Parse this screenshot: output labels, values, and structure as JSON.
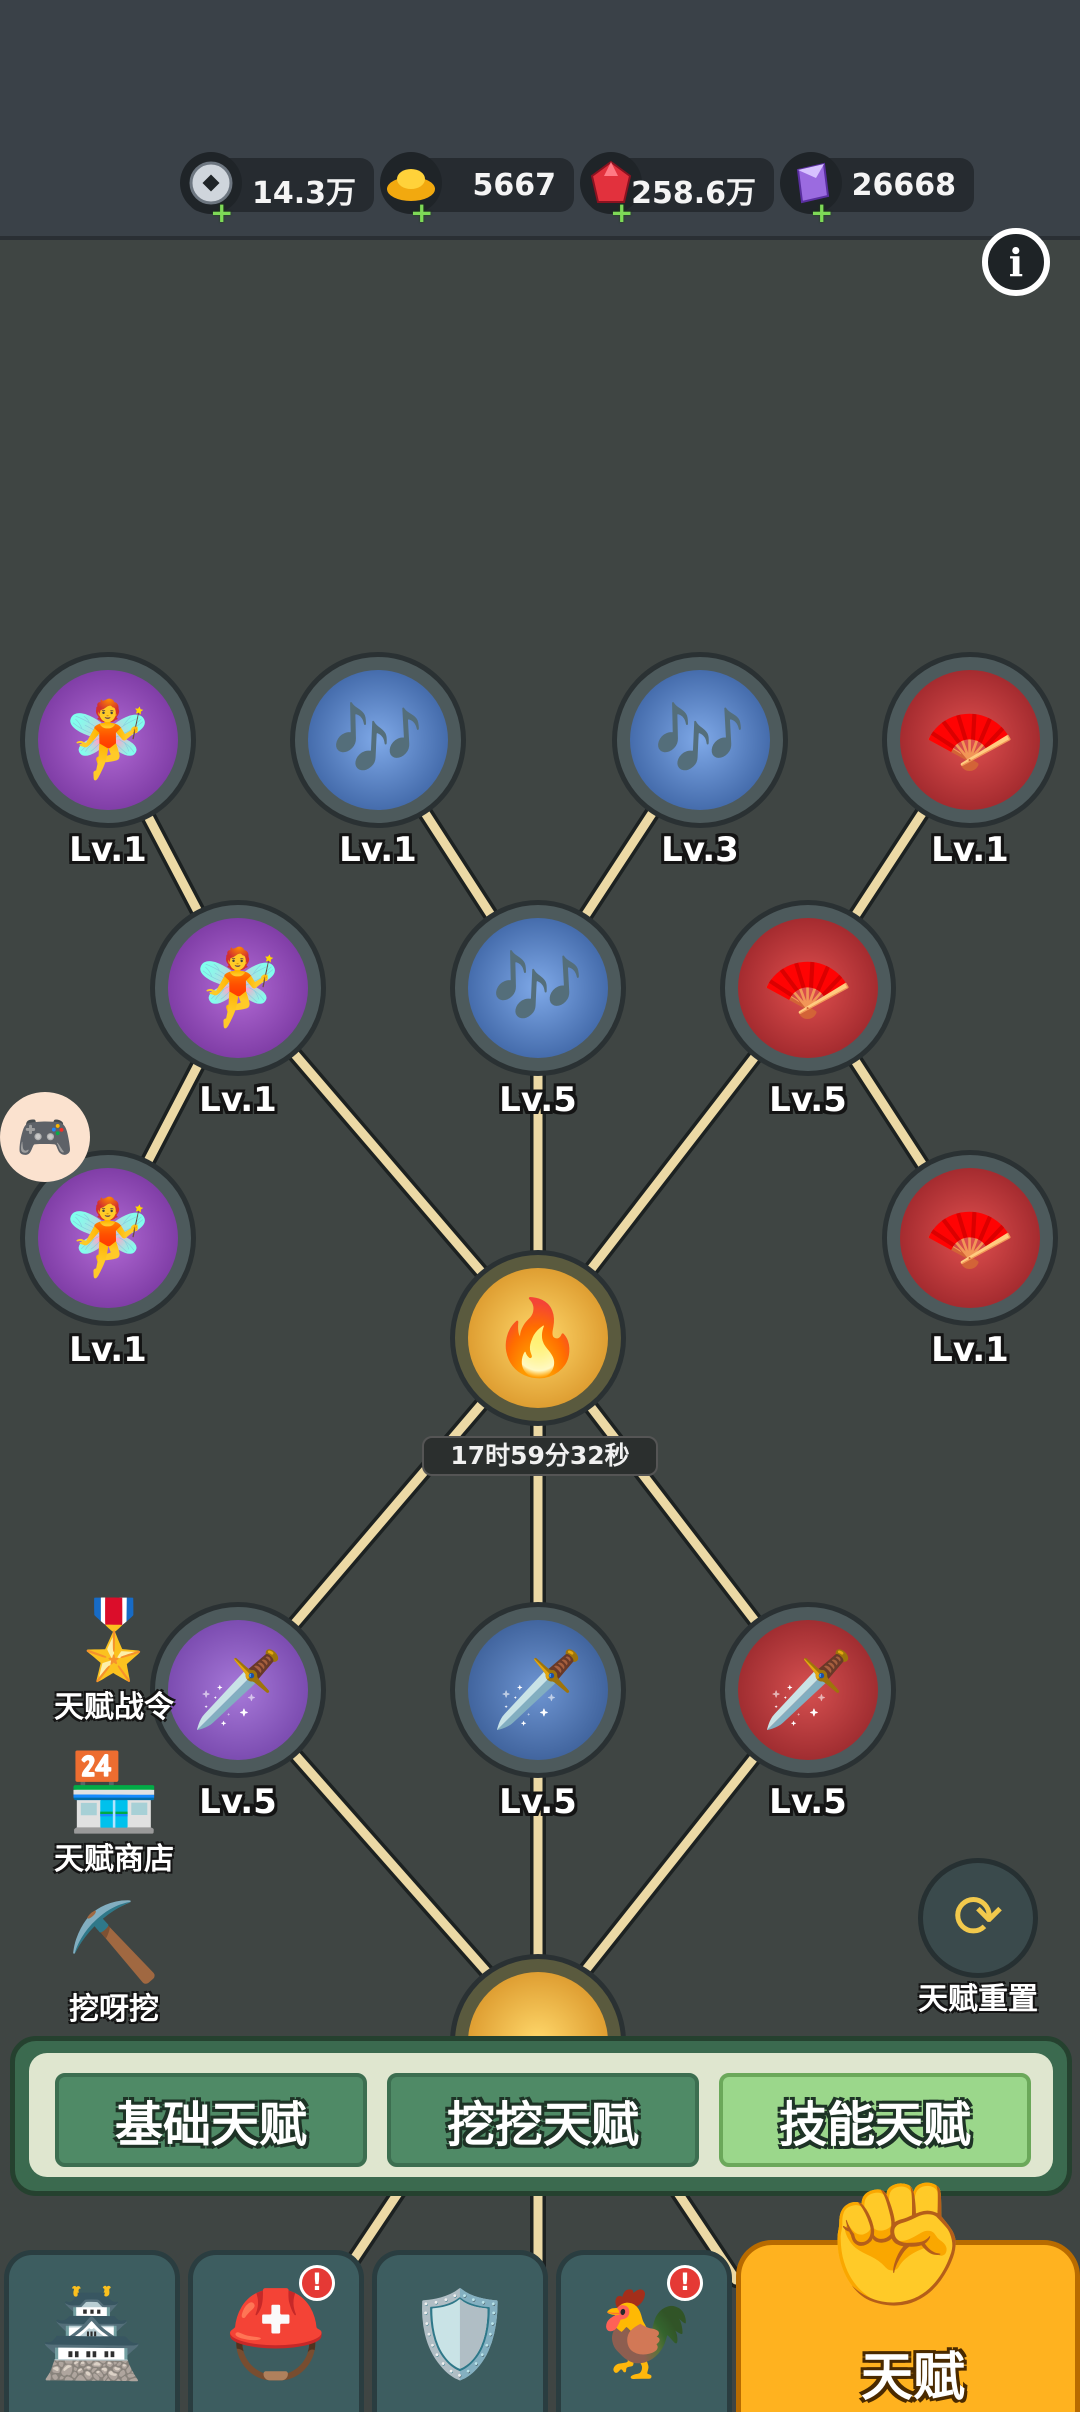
{
  "currencies": [
    {
      "name": "silver-coin-icon",
      "value": "14.3万",
      "color": "#d8dde3"
    },
    {
      "name": "gold-ingot-icon",
      "value": "5667",
      "color": "#f7c21c"
    },
    {
      "name": "red-gem-icon",
      "value": "258.6万",
      "color": "#e2313d"
    },
    {
      "name": "purple-crystal-icon",
      "value": "26668",
      "color": "#9b6be0"
    }
  ],
  "info_label": "i",
  "tree": {
    "row1": [
      {
        "icon": "fairy-icon",
        "glyph": "🧚",
        "level": "Lv.1",
        "theme": "purple"
      },
      {
        "icon": "zither-icon",
        "glyph": "🎶",
        "level": "Lv.1",
        "theme": "blue"
      },
      {
        "icon": "zither-icon",
        "glyph": "🎶",
        "level": "Lv.3",
        "theme": "blue"
      },
      {
        "icon": "fan-icon",
        "glyph": "🪭",
        "level": "Lv.1",
        "theme": "red"
      }
    ],
    "row2": [
      {
        "icon": "fairy-icon",
        "glyph": "🧚",
        "level": "Lv.1",
        "theme": "purple"
      },
      {
        "icon": "zither-icon",
        "glyph": "🎶",
        "level": "Lv.5",
        "theme": "blue"
      },
      {
        "icon": "fan-icon",
        "glyph": "🪭",
        "level": "Lv.5",
        "theme": "red"
      }
    ],
    "row3": [
      {
        "icon": "fairy-icon",
        "glyph": "🧚",
        "level": "Lv.1",
        "theme": "purple"
      },
      {
        "icon": "fan-icon",
        "glyph": "🪭",
        "level": "Lv.1",
        "theme": "red"
      }
    ],
    "core": {
      "icon": "flame-drop-icon",
      "glyph": "🔥",
      "timer": "17时59分32秒"
    },
    "row4": [
      {
        "icon": "sword-icon",
        "glyph": "🗡️",
        "level": "Lv.5",
        "theme": "purple"
      },
      {
        "icon": "sword-icon",
        "glyph": "🗡️",
        "level": "Lv.5",
        "theme": "blue"
      },
      {
        "icon": "sword-icon",
        "glyph": "🗡️",
        "level": "Lv.5",
        "theme": "red"
      }
    ]
  },
  "side_menu": [
    {
      "label": "天赋战令",
      "glyph": "🎖️"
    },
    {
      "label": "天赋商店",
      "glyph": "🏪"
    },
    {
      "label": "挖呀挖",
      "glyph": "⛏️"
    }
  ],
  "reset_label": "天赋重置",
  "tabs": [
    {
      "label": "基础天赋",
      "active": false
    },
    {
      "label": "挖挖天赋",
      "active": false
    },
    {
      "label": "技能天赋",
      "active": true
    }
  ],
  "bottom_nav": [
    {
      "name": "nav-castle",
      "glyph": "🏯",
      "badge": ""
    },
    {
      "name": "nav-helmet",
      "glyph": "⛑️",
      "badge": "!"
    },
    {
      "name": "nav-crest",
      "glyph": "🛡️",
      "badge": ""
    },
    {
      "name": "nav-rooster",
      "glyph": "🐓",
      "badge": "!"
    }
  ],
  "main_nav_label": "天赋"
}
